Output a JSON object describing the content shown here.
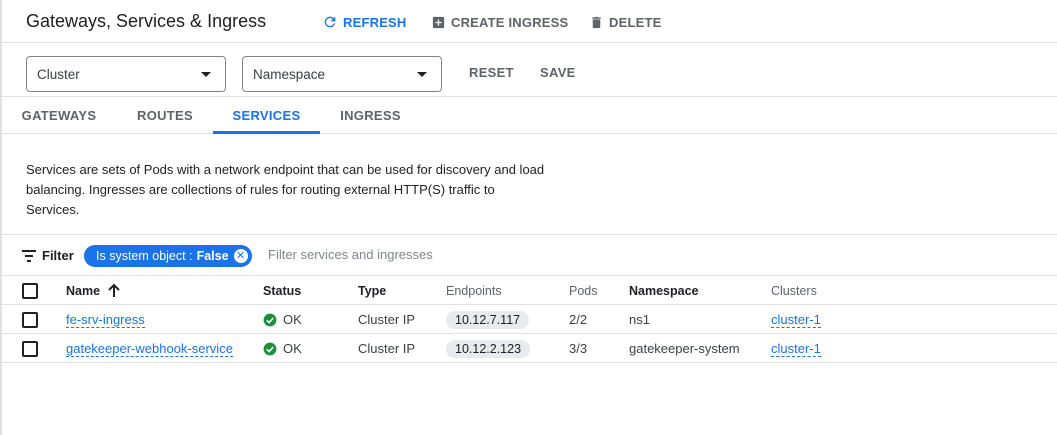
{
  "header": {
    "title": "Gateways, Services & Ingress",
    "refresh_label": "REFRESH",
    "create_label": "CREATE INGRESS",
    "delete_label": "DELETE"
  },
  "filters": {
    "cluster_label": "Cluster",
    "namespace_label": "Namespace",
    "reset_label": "RESET",
    "save_label": "SAVE"
  },
  "tabs": [
    {
      "label": "GATEWAYS",
      "active": false
    },
    {
      "label": "ROUTES",
      "active": false
    },
    {
      "label": "SERVICES",
      "active": true
    },
    {
      "label": "INGRESS",
      "active": false
    }
  ],
  "description": "Services are sets of Pods with a network endpoint that can be used for discovery and load balancing. Ingresses are collections of rules for routing external HTTP(S) traffic to Services.",
  "filterbar": {
    "label": "Filter",
    "chip_key": "Is system object :",
    "chip_value": "False",
    "placeholder": "Filter services and ingresses"
  },
  "table": {
    "columns": [
      "Name",
      "Status",
      "Type",
      "Endpoints",
      "Pods",
      "Namespace",
      "Clusters"
    ],
    "rows": [
      {
        "name": "fe-srv-ingress",
        "status": "OK",
        "type": "Cluster IP",
        "endpoints": "10.12.7.117",
        "pods": "2/2",
        "namespace": "ns1",
        "clusters": "cluster-1"
      },
      {
        "name": "gatekeeper-webhook-service",
        "status": "OK",
        "type": "Cluster IP",
        "endpoints": "10.12.2.123",
        "pods": "3/3",
        "namespace": "gatekeeper-system",
        "clusters": "cluster-1"
      }
    ]
  },
  "colors": {
    "accent": "#1a73e8",
    "ok": "#1e8e3e",
    "muted": "#5f6368"
  }
}
